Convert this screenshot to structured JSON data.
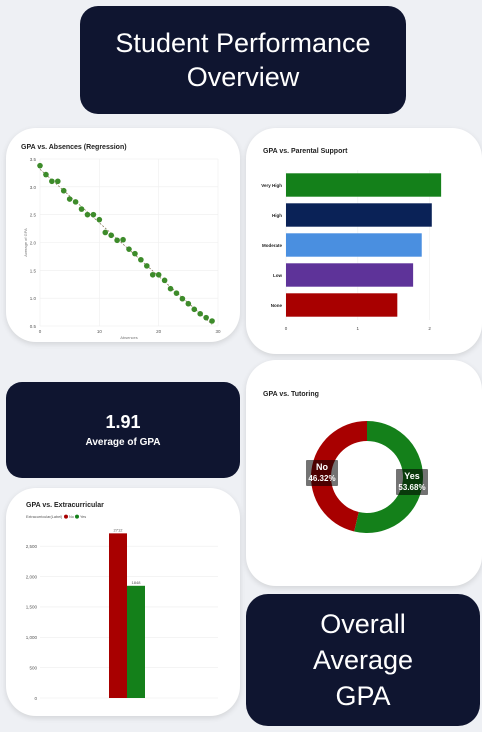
{
  "header": {
    "title_line1": "Student Performance",
    "title_line2": "Overview"
  },
  "kpi": {
    "value": "1.91",
    "label": "Average of GPA"
  },
  "footer_card": {
    "line1": "Overall",
    "line2": "Average",
    "line3": "GPA"
  },
  "colors": {
    "dark_panel": "#0f1530",
    "green": "#14801a",
    "navy": "#0a2257",
    "blue": "#4a8fe0",
    "purple": "#5e3399",
    "red": "#a80000"
  },
  "scatter_card": {
    "title": "GPA vs. Absences (Regression)",
    "xlabel": "Absences",
    "ylabel": "Average of GPA"
  },
  "bar_card": {
    "title": "GPA vs. Parental Support"
  },
  "donut_card": {
    "title": "GPA vs. Tutoring",
    "no_label": "No",
    "no_pct": "46.32%",
    "yes_label": "Yes",
    "yes_pct": "53.68%"
  },
  "column_card": {
    "title": "GPA vs. Extracurricular",
    "legend_title": "Extracurricular(Label)",
    "legend_no": "No",
    "legend_yes": "Yes"
  },
  "chart_data": [
    {
      "type": "scatter",
      "title": "GPA vs. Absences (Regression)",
      "xlabel": "Absences",
      "ylabel": "Average of GPA",
      "xlim": [
        0,
        30
      ],
      "ylim": [
        0.5,
        3.5
      ],
      "xticks": [
        "0",
        "10",
        "20",
        "30"
      ],
      "yticks": [
        "0.5",
        "1.0",
        "1.5",
        "2.0",
        "2.5",
        "3.0",
        "3.5"
      ],
      "x": [
        0,
        1,
        2,
        3,
        4,
        5,
        6,
        7,
        8,
        9,
        10,
        11,
        12,
        13,
        14,
        15,
        16,
        17,
        18,
        19,
        20,
        21,
        22,
        23,
        24,
        25,
        26,
        27,
        28,
        29
      ],
      "y": [
        3.38,
        3.22,
        3.1,
        3.1,
        2.93,
        2.78,
        2.73,
        2.6,
        2.5,
        2.5,
        2.41,
        2.18,
        2.13,
        2.04,
        2.05,
        1.88,
        1.8,
        1.69,
        1.58,
        1.42,
        1.42,
        1.32,
        1.17,
        1.09,
        0.99,
        0.9,
        0.8,
        0.72,
        0.65,
        0.59
      ],
      "color": "#3d8b2a"
    },
    {
      "type": "bar",
      "orientation": "horizontal",
      "title": "GPA vs. Parental Support",
      "categories": [
        "Very High",
        "High",
        "Moderate",
        "Low",
        "None"
      ],
      "values": [
        2.16,
        2.03,
        1.89,
        1.77,
        1.55
      ],
      "colors": [
        "#14801a",
        "#0a2257",
        "#4a8fe0",
        "#5e3399",
        "#a80000"
      ],
      "xlim": [
        0,
        2.2
      ],
      "xticks": [
        "0",
        "1",
        "2"
      ]
    },
    {
      "type": "pie",
      "title": "GPA vs. Tutoring",
      "labels": [
        "No",
        "Yes"
      ],
      "values": [
        46.32,
        53.68
      ],
      "colors": [
        "#a80000",
        "#14801a"
      ]
    },
    {
      "type": "bar",
      "title": "GPA vs. Extracurricular",
      "categories": [
        "No",
        "Yes"
      ],
      "values": [
        2712,
        1848
      ],
      "data_labels": [
        "2712",
        "1848"
      ],
      "colors": [
        "#a80000",
        "#14801a"
      ],
      "ylim": [
        0,
        2800
      ],
      "yticks": [
        "0",
        "500",
        "1,000",
        "1,500",
        "2,000",
        "2,500"
      ],
      "legend": "top-left"
    }
  ]
}
